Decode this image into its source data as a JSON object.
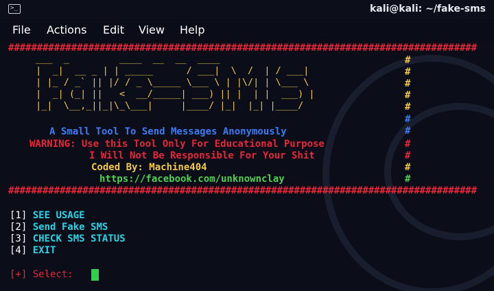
{
  "window": {
    "title": "kali@kali: ~/fake-sms",
    "icon": "terminal-icon"
  },
  "menu": [
    "File",
    "Actions",
    "Edit",
    "View",
    "Help"
  ],
  "terminal": {
    "border": "##################################################################################",
    "ascii_art": [
      " ___  _         ____  __  __  ____",
      " |  _|  __ _ | | _____      / ___|  \\  /  | / ___|",
      " | |_ / _` || |/ / _ \\_____ \\___ \\ | |\\/| | \\___ \\",
      " |  _| (_| ||   <  __/_____| ___) || |  | |  ___) |",
      " |_|  \\__,_||_|\\_\\___|     |____/ |_|  |_| |____/"
    ],
    "tagline": "A Small Tool To Send Messages Anonymously",
    "warning1": "WARNING: Use this Tool Only For Educational Purpose",
    "warning2": "I Will Not Be Responsible For Your Shit",
    "coded_by": "Coded By: Machine404",
    "url": "https://facebook.com/unknownclay",
    "hash": "#",
    "menu_options": [
      {
        "num": "[1]",
        "label": "SEE USAGE"
      },
      {
        "num": "[2]",
        "label": "Send Fake SMS"
      },
      {
        "num": "[3]",
        "label": "CHECK SMS STATUS"
      },
      {
        "num": "[4]",
        "label": "EXIT"
      }
    ],
    "prompt": "[+] Select:"
  },
  "colors": {
    "border": "#e8263a",
    "ascii": "#f2c849",
    "tagline": "#3c7cf5",
    "warning": "#e8263a",
    "coded_by": "#f2c849",
    "url": "#4fcf50",
    "option_label": "#26d4e6",
    "cursor": "#2fd14b"
  }
}
